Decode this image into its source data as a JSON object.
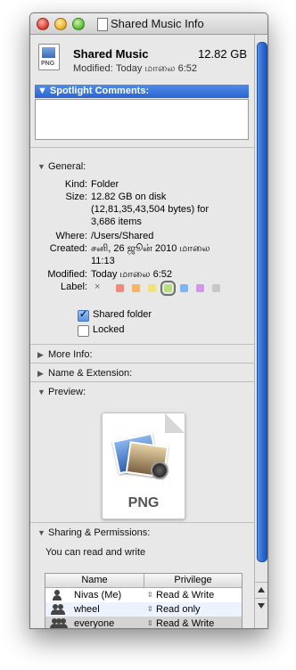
{
  "window": {
    "title": "Shared Music Info"
  },
  "header": {
    "icon_label": "PNG",
    "name": "Shared Music",
    "size": "12.82 GB",
    "modified_label": "Modified:",
    "modified_value": "Today மாலை 6:52"
  },
  "spotlight": {
    "label": "Spotlight Comments:",
    "value": ""
  },
  "general": {
    "label": "General:",
    "kind_label": "Kind:",
    "kind": "Folder",
    "size_label": "Size:",
    "size_line1": "12.82 GB on disk",
    "size_line2": "(12,81,35,43,504 bytes) for",
    "size_line3": "3,686 items",
    "where_label": "Where:",
    "where": "/Users/Shared",
    "created_label": "Created:",
    "created_line1": "சனி, 26 ஜூன் 2010 மாலை",
    "created_line2": "11:13",
    "modified_label": "Modified:",
    "modified": "Today மாலை 6:52",
    "label_label": "Label:",
    "label_none": "×",
    "label_colors": [
      "#f08a7a",
      "#f5b46a",
      "#f2e27a",
      "#b7e07a",
      "#7fb4f0",
      "#d19ae6",
      "#c8c8c8"
    ],
    "label_selected_index": 3,
    "shared_folder_label": "Shared folder",
    "shared_folder_checked": true,
    "locked_label": "Locked",
    "locked_checked": false
  },
  "sections": {
    "more_info": "More Info:",
    "name_extension": "Name & Extension:",
    "preview": "Preview:",
    "sharing": "Sharing & Permissions:"
  },
  "preview": {
    "extension": "PNG"
  },
  "sharing": {
    "access_text": "You can read and write",
    "columns": {
      "name": "Name",
      "privilege": "Privilege"
    },
    "rows": [
      {
        "name": "Nivas (Me)",
        "privilege": "Read & Write",
        "icon": "user-icon"
      },
      {
        "name": "wheel",
        "privilege": "Read only",
        "icon": "group-icon"
      },
      {
        "name": "everyone",
        "privilege": "Read & Write",
        "icon": "everyone-icon"
      }
    ]
  }
}
